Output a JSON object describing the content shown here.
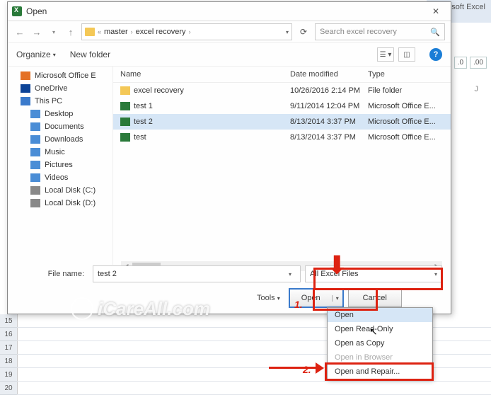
{
  "excel_bg": {
    "title": "Microsoft Excel",
    "col": "J",
    "row_start": 15,
    "numbers": [
      "15",
      "16",
      "17",
      "18",
      "19",
      "20"
    ]
  },
  "dialog": {
    "title": "Open",
    "path": {
      "root": "master",
      "sub": "excel recovery"
    },
    "search_placeholder": "Search excel recovery",
    "toolbar": {
      "organize": "Organize",
      "new_folder": "New folder"
    },
    "headers": {
      "name": "Name",
      "date": "Date modified",
      "type": "Type"
    },
    "sidebar": [
      {
        "label": "Microsoft Office E",
        "icon": "ms",
        "level": 1
      },
      {
        "label": "OneDrive",
        "icon": "one",
        "level": 1
      },
      {
        "label": "This PC",
        "icon": "pc",
        "level": 1
      },
      {
        "label": "Desktop",
        "icon": "desk",
        "level": 2
      },
      {
        "label": "Documents",
        "icon": "doc",
        "level": 2
      },
      {
        "label": "Downloads",
        "icon": "down",
        "level": 2
      },
      {
        "label": "Music",
        "icon": "music",
        "level": 2
      },
      {
        "label": "Pictures",
        "icon": "pic",
        "level": 2
      },
      {
        "label": "Videos",
        "icon": "vid",
        "level": 2
      },
      {
        "label": "Local Disk (C:)",
        "icon": "disk",
        "level": 2
      },
      {
        "label": "Local Disk (D:)",
        "icon": "disk",
        "level": 2
      }
    ],
    "files": [
      {
        "name": "excel recovery",
        "date": "10/26/2016 2:14 PM",
        "type": "File folder",
        "icon": "folder",
        "sel": false
      },
      {
        "name": "test 1",
        "date": "9/11/2014 12:04 PM",
        "type": "Microsoft Office E...",
        "icon": "excel",
        "sel": false
      },
      {
        "name": "test 2",
        "date": "8/13/2014 3:37 PM",
        "type": "Microsoft Office E...",
        "icon": "excel",
        "sel": true
      },
      {
        "name": "test",
        "date": "8/13/2014 3:37 PM",
        "type": "Microsoft Office E...",
        "icon": "excel",
        "sel": false
      }
    ],
    "filename_label": "File name:",
    "filename_value": "test 2",
    "filter": "All Excel Files",
    "tools": "Tools",
    "open_btn": "Open",
    "cancel_btn": "Cancel"
  },
  "menu": {
    "items": [
      {
        "label": "Open",
        "hl": true,
        "disabled": false
      },
      {
        "label": "Open Read-Only",
        "hl": false,
        "disabled": false
      },
      {
        "label": "Open as Copy",
        "hl": false,
        "disabled": false
      },
      {
        "label": "Open in Browser",
        "hl": false,
        "disabled": true
      },
      {
        "label": "Open and Repair...",
        "hl": false,
        "disabled": false
      }
    ]
  },
  "annotations": {
    "one": "1.",
    "two": "2.",
    "watermark": "iCareAll.com"
  }
}
